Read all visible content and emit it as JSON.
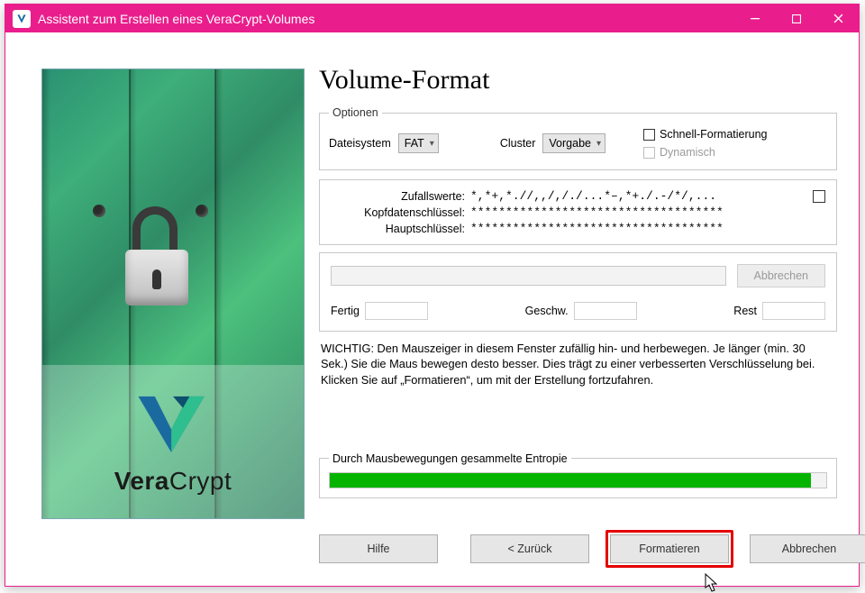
{
  "window": {
    "title": "Assistent zum Erstellen eines VeraCrypt-Volumes"
  },
  "page": {
    "heading": "Volume-Format"
  },
  "options": {
    "legend": "Optionen",
    "filesystem_label": "Dateisystem",
    "filesystem_value": "FAT",
    "cluster_label": "Cluster",
    "cluster_value": "Vorgabe",
    "quick_format_label": "Schnell-Formatierung",
    "dynamic_label": "Dynamisch"
  },
  "random": {
    "rows": {
      "zufall_label": "Zufallswerte:",
      "zufall_value": "*,*+,*.//,,/,/./...*–,*+./.-/*/,...",
      "kopf_label": "Kopfdatenschlüssel:",
      "kopf_value": "************************************",
      "haupt_label": "Hauptschlüssel:",
      "haupt_value": "************************************"
    }
  },
  "progress": {
    "abort_label": "Abbrechen",
    "done_label": "Fertig",
    "speed_label": "Geschw.",
    "rest_label": "Rest"
  },
  "important_text": "WICHTIG: Den Mauszeiger in diesem Fenster zufällig hin- und herbewegen. Je länger (min. 30 Sek.) Sie die Maus bewegen desto besser. Dies trägt zu einer verbesserten Verschlüsselung bei. Klicken Sie auf „Formatieren“, um mit der Erstellung fortzufahren.",
  "entropy": {
    "label": "Durch Mausbewegungen gesammelte Entropie",
    "percent": 97
  },
  "footer": {
    "help": "Hilfe",
    "back": "<  Zurück",
    "format": "Formatieren",
    "cancel": "Abbrechen"
  },
  "brand": {
    "name_strong": "Vera",
    "name_light": "Crypt"
  }
}
